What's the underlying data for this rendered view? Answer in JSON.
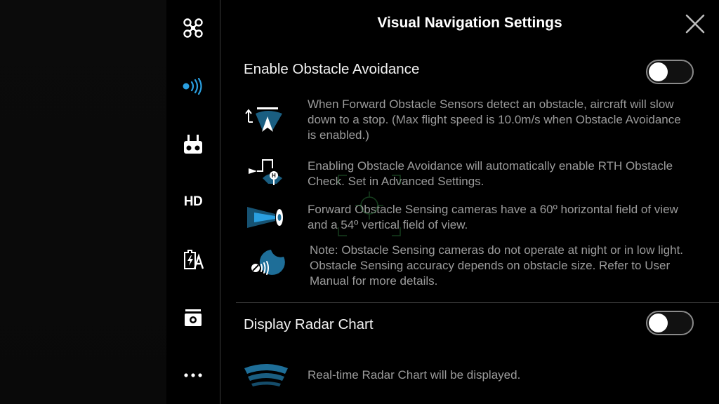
{
  "header": {
    "title": "Visual Navigation Settings"
  },
  "sidebar": {
    "items": [
      {
        "icon": "aircraft-icon"
      },
      {
        "icon": "visual-navigation-icon",
        "active": true
      },
      {
        "icon": "remote-controller-icon"
      },
      {
        "label": "HD"
      },
      {
        "icon": "battery-icon"
      },
      {
        "icon": "camera-icon"
      },
      {
        "icon": "more-icon"
      }
    ]
  },
  "obstacle_avoidance": {
    "label": "Enable Obstacle Avoidance",
    "enabled": false,
    "notes": [
      {
        "icon": "slow-down-stop-icon",
        "text": "When Forward Obstacle Sensors detect an obstacle, aircraft will slow down to a stop. (Max flight speed is 10.0m/s when Obstacle Avoidance is enabled.)"
      },
      {
        "icon": "rth-obstacle-check-icon",
        "text": "Enabling Obstacle Avoidance will automatically enable RTH Obstacle Check. Set in Advanced Settings."
      },
      {
        "icon": "sensing-field-of-view-icon",
        "text": "Forward Obstacle Sensing cameras have a 60º horizontal field of view and a 54º vertical field of view."
      },
      {
        "icon": "night-low-light-icon",
        "text": "Note: Obstacle Sensing cameras do not operate at night or in low light. Obstacle Sensing accuracy depends on obstacle size. Refer to User Manual for more details."
      }
    ]
  },
  "radar_chart": {
    "label": "Display Radar Chart",
    "enabled": false,
    "note": {
      "icon": "radar-chart-icon",
      "text": "Real-time Radar Chart will be displayed."
    }
  },
  "colors": {
    "accent": "#2a9fe0",
    "text_primary": "#f2f2f2",
    "text_secondary": "#9b9b9b",
    "divider": "#3a3a3a"
  }
}
